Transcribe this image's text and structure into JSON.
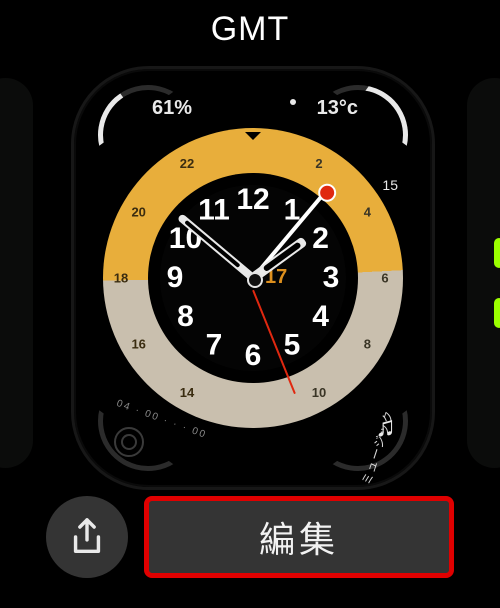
{
  "title": "GMT",
  "complications": {
    "top_left_value": "61%",
    "top_right_value": "13°c",
    "top_right_tick_label": "15",
    "bottom_left_range": "04 · 00   ·  ·  ·  00",
    "bottom_right_label": "ミュージック"
  },
  "date_label": "17",
  "hour_numbers": [
    "12",
    "1",
    "2",
    "3",
    "4",
    "5",
    "6",
    "7",
    "8",
    "9",
    "10",
    "11"
  ],
  "bezel_24": [
    "2",
    "4",
    "6",
    "8",
    "10",
    "14",
    "16",
    "18",
    "20",
    "22"
  ],
  "icons": {
    "share": "share-icon",
    "music": "music-note-icon",
    "activity": "activity-rings-icon"
  },
  "actions": {
    "edit_label": "編集"
  }
}
